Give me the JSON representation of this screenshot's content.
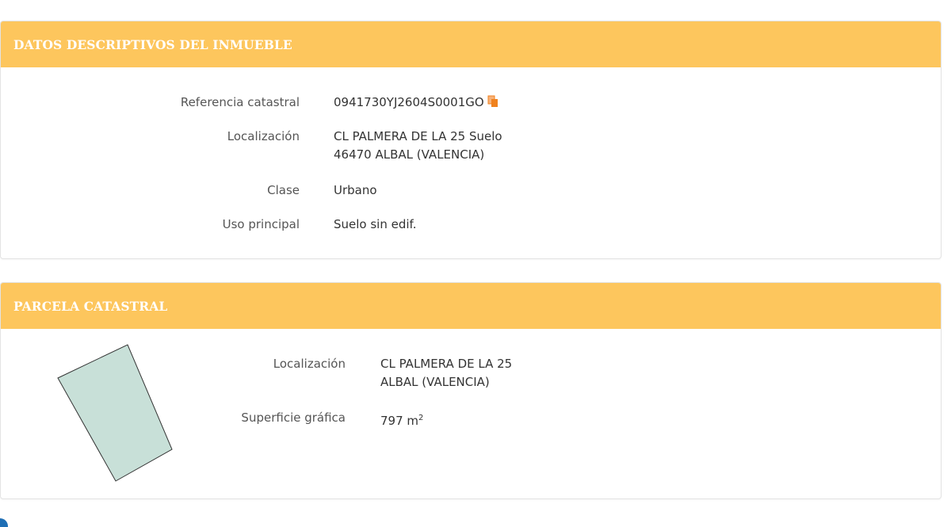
{
  "descriptive": {
    "title": "DATOS DESCRIPTIVOS DEL INMUEBLE",
    "rows": [
      {
        "label": "Referencia catastral",
        "value": "0941730YJ2604S0001GO",
        "icon": "copy-icon"
      },
      {
        "label": "Localización",
        "value_line1": "CL PALMERA DE LA 25 Suelo",
        "value_line2": "46470 ALBAL (VALENCIA)"
      },
      {
        "label": "Clase",
        "value": "Urbano"
      },
      {
        "label": "Uso principal",
        "value": "Suelo sin edif."
      }
    ]
  },
  "parcel": {
    "title": "PARCELA CATASTRAL",
    "location_label": "Localización",
    "location_line1": "CL PALMERA DE LA 25",
    "location_line2": "ALBAL (VALENCIA)",
    "area_label": "Superficie gráfica",
    "area_value": "797 m",
    "area_unit_sup": "2",
    "shape_fill": "#c8e0d8",
    "shape_stroke": "#333333"
  },
  "colors": {
    "header_bg": "#fdc65d",
    "header_text": "#ffffff",
    "icon_accent": "#f0821e",
    "info_icon": "#1f6fb5"
  }
}
